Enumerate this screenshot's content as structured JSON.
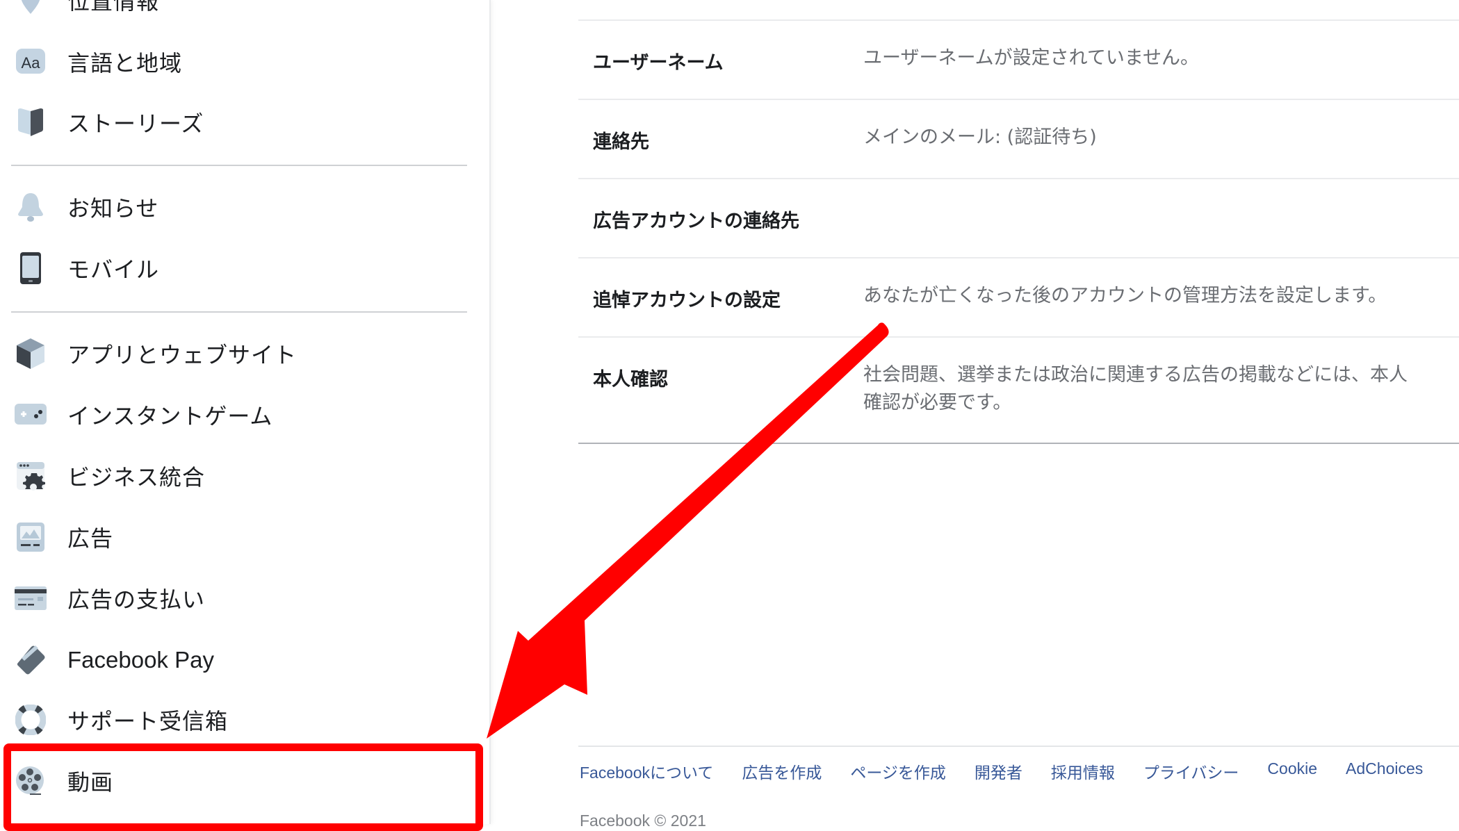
{
  "sidebar": {
    "items": [
      {
        "label": "位置情報",
        "icon": "location-pin-icon"
      },
      {
        "label": "言語と地域",
        "icon": "language-aa-icon"
      },
      {
        "label": "ストーリーズ",
        "icon": "stories-book-icon"
      },
      {
        "label": "お知らせ",
        "icon": "bell-icon"
      },
      {
        "label": "モバイル",
        "icon": "mobile-phone-icon"
      },
      {
        "label": "アプリとウェブサイト",
        "icon": "cube-icon"
      },
      {
        "label": "インスタントゲーム",
        "icon": "gamepad-icon"
      },
      {
        "label": "ビジネス統合",
        "icon": "business-gear-icon"
      },
      {
        "label": "広告",
        "icon": "ad-image-icon"
      },
      {
        "label": "広告の支払い",
        "icon": "credit-card-icon"
      },
      {
        "label": "Facebook Pay",
        "icon": "facebook-pay-card-icon"
      },
      {
        "label": "サポート受信箱",
        "icon": "lifebuoy-icon"
      },
      {
        "label": "動画",
        "icon": "film-reel-icon"
      }
    ]
  },
  "main": {
    "rows": [
      {
        "label": "ユーザーネーム",
        "value": "ユーザーネームが設定されていません。"
      },
      {
        "label": "連絡先",
        "value": "メインのメール: (認証待ち)"
      },
      {
        "label": "広告アカウントの連絡先",
        "value": ""
      },
      {
        "label": "追悼アカウントの設定",
        "value": "あなたが亡くなった後のアカウントの管理方法を設定します。"
      },
      {
        "label": "本人確認",
        "value_line1": "社会問題、選挙または政治に関連する広告の掲載などには、本人",
        "value_line2": "確認が必要です。"
      }
    ]
  },
  "footer": {
    "links": [
      "Facebookについて",
      "広告を作成",
      "ページを作成",
      "開発者",
      "採用情報",
      "プライバシー",
      "Cookie",
      "AdChoices"
    ],
    "copyright": "Facebook © 2021"
  },
  "annotation": {
    "highlight_target": "動画",
    "color": "#ff0000"
  }
}
